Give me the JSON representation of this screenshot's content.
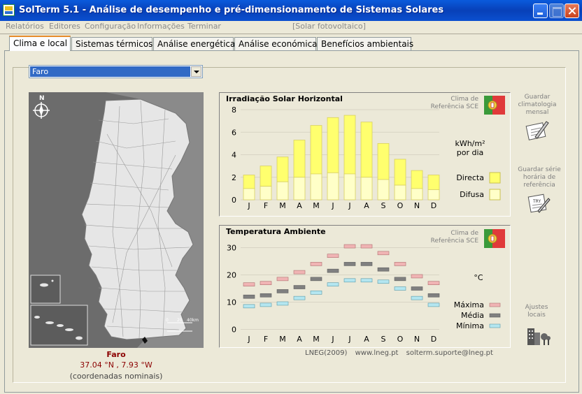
{
  "window": {
    "title": "SolTerm 5.1 - Análise de desempenho e pré-dimensionamento de Sistemas Solares"
  },
  "menu": {
    "items": [
      "Relatórios",
      "Editores",
      "Configuração",
      "Informações",
      "Terminar"
    ],
    "context_label": "[Solar fotovoltaico]"
  },
  "tabs": [
    "Clima e local",
    "Sistemas térmicos",
    "Análise energética",
    "Análise económica",
    "Benefícios ambientais"
  ],
  "location": {
    "selected": "Faro",
    "name": "Faro",
    "coords": "37.04 °N , 7.93 °W",
    "note": "(coordenadas nominais)"
  },
  "map": {
    "north_label": "N",
    "scale_labels": [
      "0",
      "20",
      "40km"
    ]
  },
  "climate_label": "Clima de\nReferência SCE",
  "side_actions": {
    "save_monthly": "Guardar\nclimatologia\nmensal",
    "save_hourly": "Guardar série\nhorária de\nreferência",
    "local_adjust": "Ajustes\nlocais"
  },
  "footer": {
    "source": "LNEG(2009)",
    "website": "www.lneg.pt",
    "email": "solterm.suporte@lneg.pt"
  },
  "chart_data": [
    {
      "type": "bar",
      "title": "Irradiação Solar Horizontal",
      "unit_label": "kWh/m²\npor dia",
      "categories": [
        "J",
        "F",
        "M",
        "A",
        "M",
        "J",
        "J",
        "A",
        "S",
        "O",
        "N",
        "D"
      ],
      "series": [
        {
          "name": "Directa",
          "values": [
            1.2,
            1.8,
            2.2,
            3.3,
            4.3,
            4.9,
            5.2,
            4.9,
            3.2,
            2.3,
            1.6,
            1.3
          ],
          "color": "#ffff6e"
        },
        {
          "name": "Difusa",
          "values": [
            1.0,
            1.2,
            1.6,
            2.0,
            2.3,
            2.4,
            2.3,
            2.0,
            1.8,
            1.3,
            1.0,
            0.9
          ],
          "color": "#ffffc8"
        }
      ],
      "yticks": [
        0,
        2,
        4,
        6,
        8
      ],
      "ylim": [
        0,
        8
      ],
      "grid": true
    },
    {
      "type": "scatter",
      "title": "Temperatura Ambiente",
      "unit_label": "°C",
      "categories": [
        "J",
        "F",
        "M",
        "A",
        "M",
        "J",
        "J",
        "A",
        "S",
        "O",
        "N",
        "D"
      ],
      "series": [
        {
          "name": "Máxima",
          "values": [
            16.5,
            17,
            18.5,
            21,
            24,
            27,
            30.5,
            30.5,
            28,
            24,
            19.5,
            17
          ],
          "color": "#f0b4b4"
        },
        {
          "name": "Média",
          "values": [
            12,
            12.5,
            14,
            15.5,
            18.5,
            21.5,
            24,
            24,
            22,
            18.5,
            15,
            12.5
          ],
          "color": "#808080"
        },
        {
          "name": "Mínima",
          "values": [
            8.5,
            9,
            9.5,
            11.5,
            13.5,
            16.5,
            18,
            18,
            17.5,
            15,
            11.5,
            9
          ],
          "color": "#b4e6f0"
        }
      ],
      "yticks": [
        0,
        10,
        20,
        30
      ],
      "ylim": [
        -5,
        35
      ],
      "grid": true
    }
  ]
}
